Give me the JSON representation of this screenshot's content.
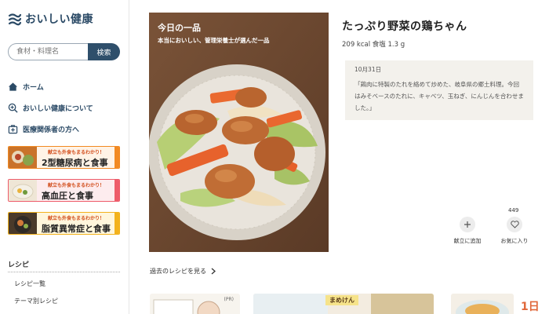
{
  "logo": {
    "text": "おいしい健康"
  },
  "search": {
    "placeholder": "食材・料理名",
    "button": "検索"
  },
  "nav": [
    {
      "label": "ホーム",
      "icon": "home-icon"
    },
    {
      "label": "おいしい健康について",
      "icon": "plus-search-icon"
    },
    {
      "label": "医療関係者の方へ",
      "icon": "medical-icon"
    }
  ],
  "banners": [
    {
      "tagline": "献立も外食もまるわかり！",
      "title": "2型糖尿病と食事",
      "color": "#f28a22"
    },
    {
      "tagline": "献立も外食もまるわかり！",
      "title": "高血圧と食事",
      "color": "#ee5c6a"
    },
    {
      "tagline": "献立も外食もまるわかり！",
      "title": "脂質異常症と食事",
      "color": "#f3b21d"
    }
  ],
  "recipe_section": {
    "label": "レシピ",
    "items": [
      "レシピ一覧",
      "テーマ別レシピ"
    ]
  },
  "hero": {
    "title": "今日の一品",
    "subtitle": "本当においしい、管理栄養士が選んだ一品"
  },
  "recipe": {
    "title": "たっぷり野菜の鶏ちゃん",
    "meta": "209 kcal 食塩 1.3 g",
    "date": "10月31日",
    "description": "「鶏肉に特製のたれを絡めて炒めた、岐阜県の郷土料理。今回はみそベースのたれに、キャベツ、玉ねぎ、にんじんを合わせました。」"
  },
  "actions": {
    "add_label": "献立に追加",
    "fav_label": "お気に入り",
    "fav_count": "449"
  },
  "past_link": "過去のレシピを見る",
  "cards": {
    "pr": "(PR)",
    "mameken": "まめけん",
    "day": "1日"
  }
}
